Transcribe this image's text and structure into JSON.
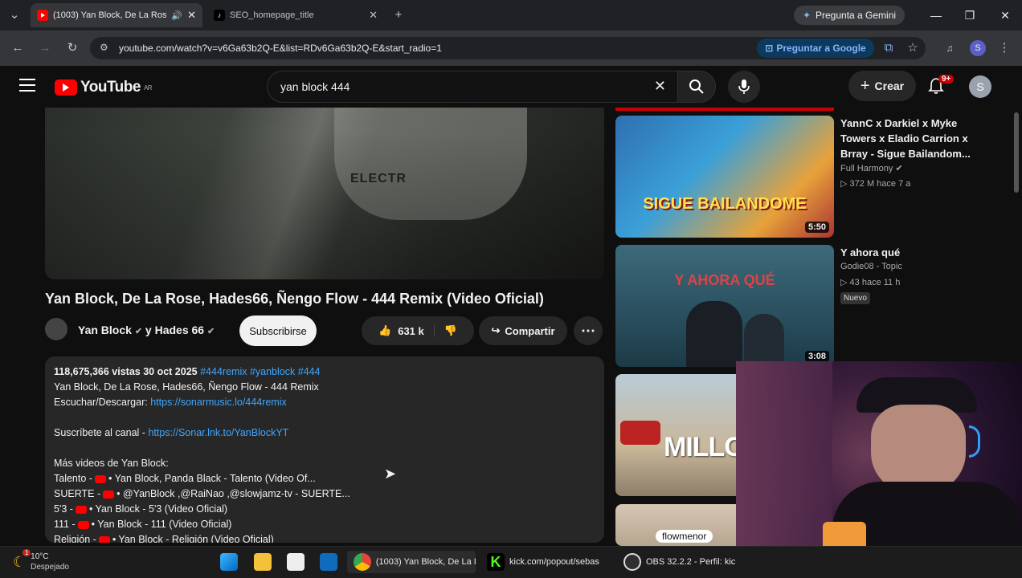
{
  "browser": {
    "tabs": [
      {
        "label": "(1003) Yan Block, De La Ros"
      },
      {
        "label": "SEO_homepage_title"
      }
    ],
    "gemini_label": "Pregunta a Gemini",
    "url": "youtube.com/watch?v=v6Ga63b2Q-E&list=RDv6Ga63b2Q-E&start_radio=1",
    "google_pill": "Preguntar a Google",
    "profile_letter": "S"
  },
  "youtube": {
    "logo_text": "YouTube",
    "region": "AR",
    "search_value": "yan block 444",
    "create_label": "Crear",
    "notif_badge": "9+",
    "avatar_letter": "S"
  },
  "video": {
    "title": "Yan Block, De La Rose, Hades66, Ñengo Flow - 444 Remix (Video Oficial)",
    "channel": "Yan Block",
    "channel_joiner": "y Hades 66",
    "subscribe_label": "Subscribirse",
    "likes": "631 k",
    "share_label": "Compartir",
    "desc": {
      "stats": "118,675,366 vistas  30 oct 2025",
      "hashtags": "#444remix #yanblock #444",
      "line1": "Yan Block, De La Rose, Hades66, Ñengo Flow - 444 Remix",
      "listen_label": "Escuchar/Descargar:",
      "listen_link": "https://sonarmusic.lo/444remix",
      "sub_label": "Suscríbete al canal -",
      "sub_link": "https://Sonar.lnk.to/YanBlockYT",
      "more_label": "Más videos de Yan Block:",
      "items": [
        {
          "prefix": "Talento -",
          "text": "• Yan Block, Panda Black - Talento (Video Of..."
        },
        {
          "prefix": "SUERTE -",
          "text": "• @YanBlock ,@RaiNao ,@slowjamz-tv  - SUERTE..."
        },
        {
          "prefix": "5'3 -",
          "text": "• Yan Block - 5'3 (Video Oficial)"
        },
        {
          "prefix": "111 -",
          "text": "• Yan Block - 111 (Video Oficial)"
        },
        {
          "prefix": "Religión -",
          "text": "• Yan Block - Religión (Video Oficial)"
        }
      ]
    }
  },
  "sidebar": {
    "items": [
      {
        "title": "YannC x Darkiel x Myke Towers x Eladio Carrion x Brray - Sigue Bailandom...",
        "channel": "Full Harmony",
        "views": "372 M",
        "age": "hace 7 a",
        "duration": "5:50",
        "thumb_text": "SIGUE BAILANDOME"
      },
      {
        "title": "Y ahora qué",
        "channel": "Godie08 - Topic",
        "views": "43",
        "age": "hace 11 h",
        "badge": "Nuevo",
        "duration": "3:08",
        "thumb_text": "Y AHORA QUÉ"
      },
      {
        "thumb_text": "MILLON"
      },
      {
        "thumb_text": "flowmenor"
      }
    ]
  },
  "taskbar": {
    "temp": "10°C",
    "weather": "Despejado",
    "weather_badge": "1",
    "apps": [
      {
        "label": "(1003) Yan Block, De La I"
      },
      {
        "label": "kick.com/popout/sebas"
      },
      {
        "label": "OBS 32.2.2 - Perfil: kic"
      }
    ]
  }
}
